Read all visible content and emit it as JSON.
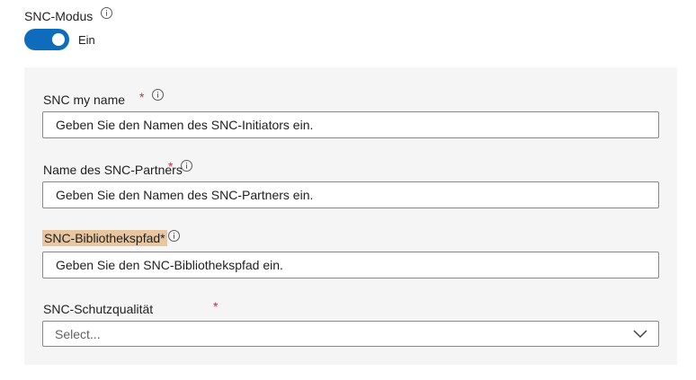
{
  "mode": {
    "label": "SNC-Modus",
    "info_icon": "info-icon",
    "toggle_on": true,
    "toggle_state_label": "Ein",
    "accent_color": "#0f6cbd"
  },
  "fields": {
    "my_name": {
      "label": "SNC my name",
      "required_marker": "*",
      "placeholder": "Geben Sie den Namen des SNC-Initiators ein."
    },
    "partner_name": {
      "label": "Name des SNC-Partners",
      "required_marker": "*",
      "placeholder": "Geben Sie den Namen des SNC-Partners ein."
    },
    "library_path": {
      "label": "SNC-Bibliothekspfad*",
      "placeholder": "Geben Sie den SNC-Bibliothekspfad ein."
    },
    "protection_quality": {
      "label": "SNC-Schutzqualität",
      "required_marker": "*",
      "selected_value": "Select...",
      "icon": "chevron-down-icon"
    }
  },
  "colors": {
    "required": "#c4314b",
    "highlight": "#e8c6a0",
    "panel_background": "#f5f5f5"
  }
}
